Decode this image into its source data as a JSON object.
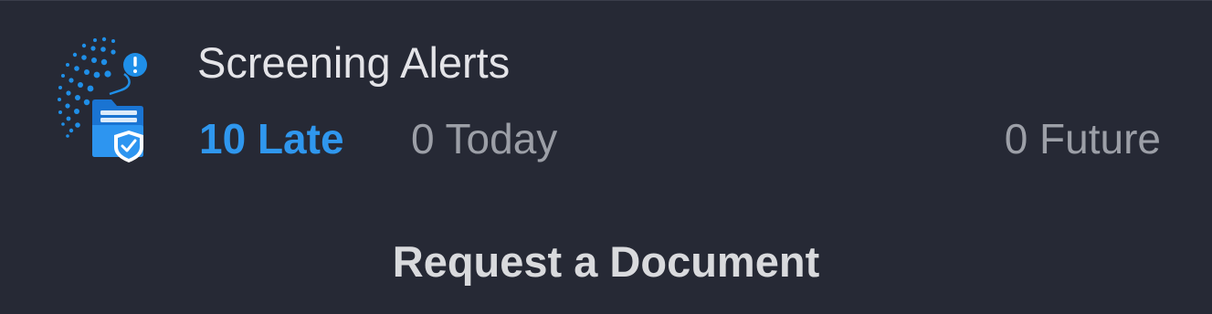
{
  "widget": {
    "title": "Screening Alerts",
    "icon": "screening-alert-folder-shield-icon",
    "stats": {
      "late": "10 Late",
      "today": "0 Today",
      "future": "0 Future"
    },
    "action_label": "Request a Document"
  },
  "colors": {
    "background": "#262935",
    "accent": "#2f97ee",
    "title_text": "#e4e4e8",
    "muted_text": "#9c9fa7",
    "action_text": "#d9dadd"
  }
}
